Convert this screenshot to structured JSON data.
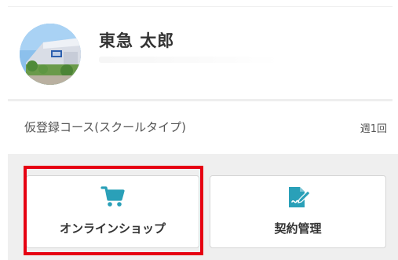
{
  "user": {
    "name": "東急 太郎",
    "avatar_icon": "building-photo-avatar"
  },
  "plan": {
    "name": "仮登録コース(スクールタイプ)",
    "frequency": "週1回"
  },
  "menu": {
    "items": [
      {
        "label": "オンラインショップ",
        "icon": "cart-icon"
      },
      {
        "label": "契約管理",
        "icon": "contract-edit-icon"
      }
    ]
  },
  "colors": {
    "accent": "#2aa0b8",
    "highlight": "#e60012",
    "panel": "#efefef"
  }
}
